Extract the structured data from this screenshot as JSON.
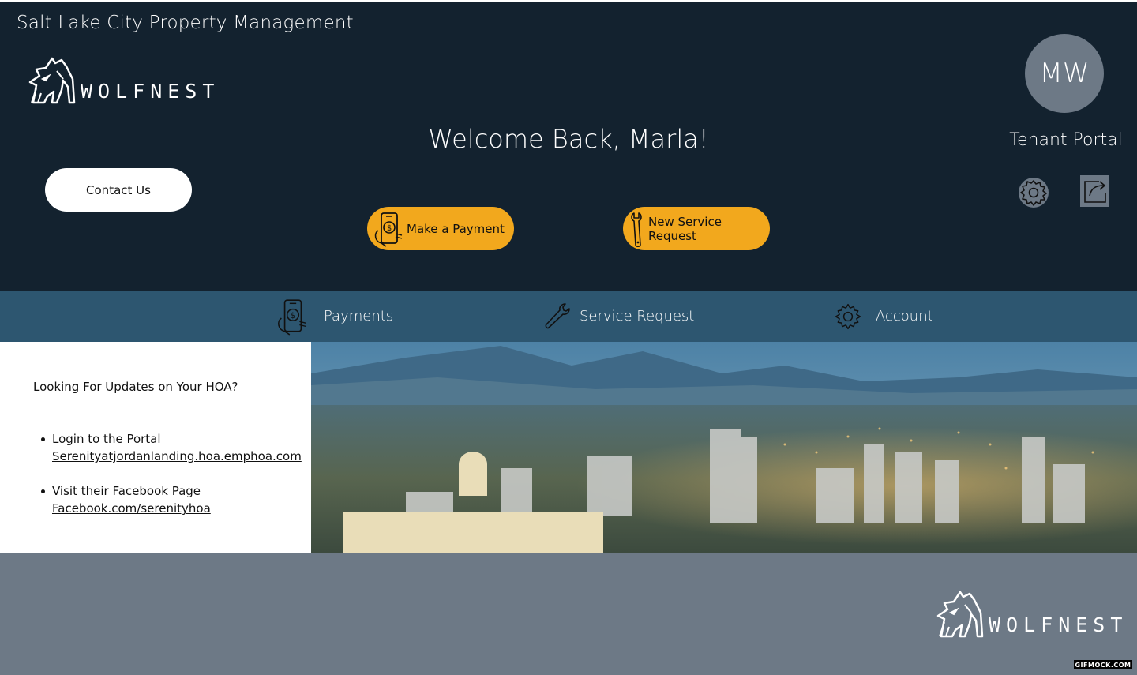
{
  "header": {
    "brand_title": "Salt Lake City Property Management",
    "logo_text": "WOLFNEST",
    "welcome": "Welcome Back, Marla!",
    "contact_label": "Contact Us",
    "make_payment_label": "Make a Payment",
    "service_request_label": "New Service Request",
    "avatar_initials": "MW",
    "portal_label": "Tenant Portal",
    "icons": [
      "settings-gear-icon",
      "logout-share-icon"
    ]
  },
  "nav": {
    "items": [
      {
        "label": "Payments",
        "icon": "phone-payment-icon"
      },
      {
        "label": "Service Request",
        "icon": "wrench-icon"
      },
      {
        "label": "Account",
        "icon": "gear-icon"
      }
    ]
  },
  "hoa": {
    "title": "Looking For Updates on Your HOA?",
    "items": [
      {
        "text": "Login to the Portal",
        "link": "Serenityatjordanlanding.hoa.emphoa.com"
      },
      {
        "text": "Visit their Facebook Page",
        "link": "Facebook.com/serenityhoa"
      }
    ]
  },
  "footer": {
    "logo_text": "WOLFNEST",
    "watermark": "GIFMOCK.COM"
  },
  "colors": {
    "header_bg": "#13222f",
    "nav_bg": "#2d5670",
    "accent": "#f2a81d",
    "footer_bg": "#6d7986",
    "panel_bg": "#ffffff"
  }
}
